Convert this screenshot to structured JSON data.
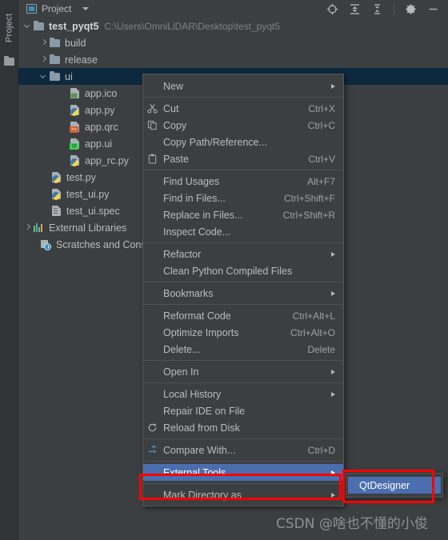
{
  "window": {
    "title": "Project"
  },
  "toolbar": {
    "project_label": "Project",
    "icons": [
      {
        "name": "locate-icon",
        "glyph": "target"
      },
      {
        "name": "collapse-all-icon",
        "glyph": "collapse"
      },
      {
        "name": "expand-all-icon",
        "glyph": "expand"
      },
      {
        "name": "settings-gear-icon",
        "glyph": "gear"
      },
      {
        "name": "minimize-icon",
        "glyph": "minus"
      }
    ]
  },
  "sidebar": {
    "vertical_tab": "Project"
  },
  "tree": {
    "rows": [
      {
        "label": "test_pyqt5",
        "path": "C:\\Users\\OmniLiDAR\\Desktop\\test_pyqt5",
        "icon": "folder-icon",
        "indent": 0,
        "arrow": "down",
        "bold": true,
        "selected": false
      },
      {
        "label": "build",
        "path": "",
        "icon": "folder-icon",
        "indent": 1,
        "arrow": "right",
        "bold": false,
        "selected": false
      },
      {
        "label": "release",
        "path": "",
        "icon": "folder-icon",
        "indent": 1,
        "arrow": "right",
        "bold": false,
        "selected": false
      },
      {
        "label": "ui",
        "path": "",
        "icon": "folder-icon",
        "indent": 1,
        "arrow": "down",
        "bold": false,
        "selected": true
      },
      {
        "label": "app.ico",
        "path": "",
        "icon": "image-file-icon",
        "indent": 3,
        "arrow": "none",
        "bold": false,
        "selected": false
      },
      {
        "label": "app.py",
        "path": "",
        "icon": "python-file-icon",
        "indent": 3,
        "arrow": "none",
        "bold": false,
        "selected": false
      },
      {
        "label": "app.qrc",
        "path": "",
        "icon": "qrc-file-icon",
        "indent": 3,
        "arrow": "none",
        "bold": false,
        "selected": false
      },
      {
        "label": "app.ui",
        "path": "",
        "icon": "qt-ui-file-icon",
        "indent": 3,
        "arrow": "none",
        "bold": false,
        "selected": false
      },
      {
        "label": "app_rc.py",
        "path": "",
        "icon": "python-file-icon",
        "indent": 3,
        "arrow": "none",
        "bold": false,
        "selected": false
      },
      {
        "label": "test.py",
        "path": "",
        "icon": "python-file-icon",
        "indent": 2,
        "arrow": "none",
        "bold": false,
        "selected": false
      },
      {
        "label": "test_ui.py",
        "path": "",
        "icon": "python-file-icon",
        "indent": 2,
        "arrow": "none",
        "bold": false,
        "selected": false
      },
      {
        "label": "test_ui.spec",
        "path": "",
        "icon": "text-file-icon",
        "indent": 2,
        "arrow": "none",
        "bold": false,
        "selected": false
      },
      {
        "label": "External Libraries",
        "path": "",
        "icon": "libraries-icon",
        "indent": 1,
        "arrow": "right",
        "bold": false,
        "selected": false
      },
      {
        "label": "Scratches and Cons",
        "path": "",
        "icon": "scratches-icon",
        "indent": 1,
        "arrow": "none",
        "bold": false,
        "selected": false
      }
    ]
  },
  "context_menu": {
    "items": [
      {
        "type": "item",
        "label": "New",
        "shortcut": "",
        "icon": "",
        "submenu": true,
        "highlight": false
      },
      {
        "type": "sep"
      },
      {
        "type": "item",
        "label": "Cut",
        "shortcut": "Ctrl+X",
        "icon": "scissors-icon",
        "submenu": false,
        "highlight": false
      },
      {
        "type": "item",
        "label": "Copy",
        "shortcut": "Ctrl+C",
        "icon": "copy-icon",
        "submenu": false,
        "highlight": false
      },
      {
        "type": "item",
        "label": "Copy Path/Reference...",
        "shortcut": "",
        "icon": "",
        "submenu": false,
        "highlight": false
      },
      {
        "type": "item",
        "label": "Paste",
        "shortcut": "Ctrl+V",
        "icon": "clipboard-icon",
        "submenu": false,
        "highlight": false
      },
      {
        "type": "sep"
      },
      {
        "type": "item",
        "label": "Find Usages",
        "shortcut": "Alt+F7",
        "icon": "",
        "submenu": false,
        "highlight": false
      },
      {
        "type": "item",
        "label": "Find in Files...",
        "shortcut": "Ctrl+Shift+F",
        "icon": "",
        "submenu": false,
        "highlight": false
      },
      {
        "type": "item",
        "label": "Replace in Files...",
        "shortcut": "Ctrl+Shift+R",
        "icon": "",
        "submenu": false,
        "highlight": false
      },
      {
        "type": "item",
        "label": "Inspect Code...",
        "shortcut": "",
        "icon": "",
        "submenu": false,
        "highlight": false
      },
      {
        "type": "sep"
      },
      {
        "type": "item",
        "label": "Refactor",
        "shortcut": "",
        "icon": "",
        "submenu": true,
        "highlight": false
      },
      {
        "type": "item",
        "label": "Clean Python Compiled Files",
        "shortcut": "",
        "icon": "",
        "submenu": false,
        "highlight": false
      },
      {
        "type": "sep"
      },
      {
        "type": "item",
        "label": "Bookmarks",
        "shortcut": "",
        "icon": "",
        "submenu": true,
        "highlight": false
      },
      {
        "type": "sep"
      },
      {
        "type": "item",
        "label": "Reformat Code",
        "shortcut": "Ctrl+Alt+L",
        "icon": "",
        "submenu": false,
        "highlight": false
      },
      {
        "type": "item",
        "label": "Optimize Imports",
        "shortcut": "Ctrl+Alt+O",
        "icon": "",
        "submenu": false,
        "highlight": false
      },
      {
        "type": "item",
        "label": "Delete...",
        "shortcut": "Delete",
        "icon": "",
        "submenu": false,
        "highlight": false
      },
      {
        "type": "sep"
      },
      {
        "type": "item",
        "label": "Open In",
        "shortcut": "",
        "icon": "",
        "submenu": true,
        "highlight": false
      },
      {
        "type": "sep"
      },
      {
        "type": "item",
        "label": "Local History",
        "shortcut": "",
        "icon": "",
        "submenu": true,
        "highlight": false
      },
      {
        "type": "item",
        "label": "Repair IDE on File",
        "shortcut": "",
        "icon": "",
        "submenu": false,
        "highlight": false
      },
      {
        "type": "item",
        "label": "Reload from Disk",
        "shortcut": "",
        "icon": "reload-icon",
        "submenu": false,
        "highlight": false
      },
      {
        "type": "sep"
      },
      {
        "type": "item",
        "label": "Compare With...",
        "shortcut": "Ctrl+D",
        "icon": "compare-icon",
        "submenu": false,
        "highlight": false
      },
      {
        "type": "sep"
      },
      {
        "type": "item",
        "label": "External Tools",
        "shortcut": "",
        "icon": "",
        "submenu": true,
        "highlight": true
      },
      {
        "type": "sep"
      },
      {
        "type": "item",
        "label": "Mark Directory as",
        "shortcut": "",
        "icon": "",
        "submenu": true,
        "highlight": false
      }
    ]
  },
  "submenu": {
    "items": [
      {
        "label": "QtDesigner",
        "highlight": true
      }
    ]
  },
  "annotations": {
    "highlight_color": "#ff0000",
    "boxes": [
      {
        "name": "external-tools-callout"
      },
      {
        "name": "qtdesigner-callout"
      }
    ]
  },
  "watermark": {
    "text": "CSDN @啥也不懂的小俊"
  },
  "colors": {
    "background": "#3c3f41",
    "selection_tree": "#0d293e",
    "selection_menu": "#4b6eaf",
    "text": "#bbbbbb",
    "muted_text": "#808080",
    "accent": "#3592c4"
  }
}
